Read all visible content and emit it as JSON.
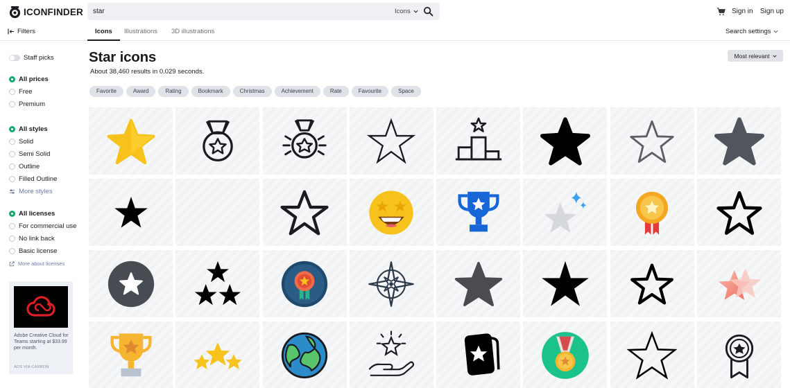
{
  "header": {
    "logo_text": "ICONFINDER",
    "search_value": "star",
    "search_type": "Icons",
    "sign_in": "Sign in",
    "sign_up": "Sign up"
  },
  "subbar": {
    "filters_label": "Filters",
    "tabs": [
      {
        "label": "Icons",
        "active": true
      },
      {
        "label": "Illustrations",
        "active": false
      },
      {
        "label": "3D illustrations",
        "active": false
      }
    ],
    "search_settings": "Search settings"
  },
  "sidebar": {
    "staff_picks": "Staff picks",
    "prices": [
      "All prices",
      "Free",
      "Premium"
    ],
    "styles": [
      "All styles",
      "Solid",
      "Semi Solid",
      "Outline",
      "Filled Outline"
    ],
    "more_styles": "More styles",
    "licenses": [
      "All licenses",
      "For commercial use",
      "No link back",
      "Basic license"
    ],
    "more_licenses": "More about licenses",
    "ad": {
      "text": "Adobe Creative Cloud for Teams starting at $33.99 per month.",
      "via": "ADS VIA CARBON"
    }
  },
  "main": {
    "title": "Star icons",
    "results": "About 38,460 results in 0.029 seconds.",
    "sort": "Most relevant",
    "chips": [
      "Favorite",
      "Award",
      "Rating",
      "Bookmark",
      "Christmas",
      "Achievement",
      "Rate",
      "Favourite",
      "Space"
    ]
  },
  "icons": [
    "star-gold-flat-icon",
    "medal-outline-icon",
    "medal-shining-outline-icon",
    "star-outline-thin-icon",
    "podium-star-outline-icon",
    "star-solid-black-icon",
    "star-outline-gray-icon",
    "star-solid-gray-icon",
    "star-solid-small-icon",
    "empty-cell",
    "star-outline-bold-icon",
    "star-eyes-emoji-icon",
    "trophy-blue-icon",
    "star-sparkle-gray-icon",
    "rosette-gold-icon",
    "star-outline-rounded-icon",
    "star-circle-dark-icon",
    "three-stars-icon",
    "badge-circle-icon",
    "compass-rose-icon",
    "star-solid-dark-gray-icon",
    "star-solid-sharp-icon",
    "star-outline-medium-icon",
    "stars-gradient-pink-icon",
    "trophy-gold-icon",
    "three-stars-gold-icon",
    "globe-earth-icon",
    "hand-star-outline-icon",
    "card-star-icon",
    "medal-green-circle-icon",
    "star-outline-large-icon",
    "award-ribbon-outline-icon"
  ],
  "colors": {
    "accent_green": "#11a86e",
    "gold": "#f7c21b",
    "dark_gray": "#51555d",
    "blue": "#1766d8"
  }
}
